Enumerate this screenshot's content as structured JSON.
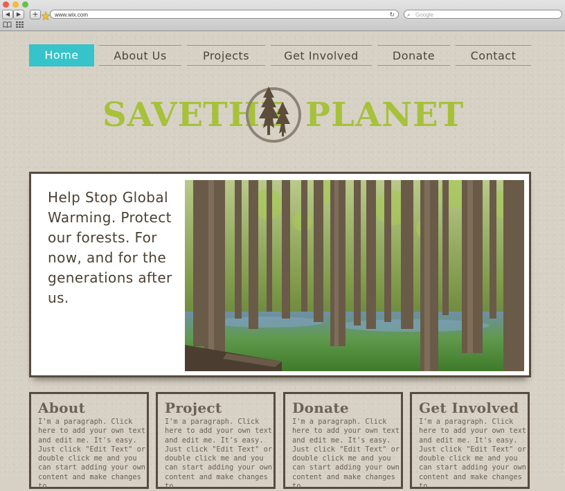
{
  "browser": {
    "url": "www.wix.com",
    "search_placeholder": "Google",
    "icons": {
      "back": "back-arrow-icon",
      "forward": "forward-arrow-icon",
      "add": "plus-icon",
      "reload": "reload-icon",
      "search": "search-icon",
      "bookmarks": "book-icon",
      "grid": "grid-icon"
    }
  },
  "nav": {
    "items": [
      {
        "label": "Home",
        "active": true
      },
      {
        "label": "About Us",
        "active": false
      },
      {
        "label": "Projects",
        "active": false
      },
      {
        "label": "Get Involved",
        "active": false
      },
      {
        "label": "Donate",
        "active": false
      },
      {
        "label": "Contact",
        "active": false
      }
    ],
    "active_color": "#36c3c9"
  },
  "logo": {
    "word1": "SAVE",
    "word2": "THE",
    "word3": "PLANET",
    "color": "#a6c13a",
    "emblem": "pine-tree-icon"
  },
  "hero": {
    "text": "Help Stop Global Warming. Protect our forests. For now, and for the generations after us.",
    "image": "forest-photo"
  },
  "cards": [
    {
      "title": "About",
      "body": "I'm a paragraph. Click here to add your own text and edit me. It's easy. Just click \"Edit Text\" or double click me and you can start adding your own content and make changes to"
    },
    {
      "title": "Project",
      "body": "I'm a paragraph. Click here to add your own text and edit me. It's easy. Just click \"Edit Text\" or double click me and you can start adding your own content and make changes to"
    },
    {
      "title": "Donate",
      "body": "I'm a paragraph. Click here to add your own text and edit me. It's easy. Just click \"Edit Text\" or double click me and you can start adding your own content and make changes to"
    },
    {
      "title": "Get Involved",
      "body": "I'm a paragraph. Click here to add your own text and edit me. It's easy. Just click \"Edit Text\" or double click me and you can start adding your own content and make changes to"
    }
  ]
}
